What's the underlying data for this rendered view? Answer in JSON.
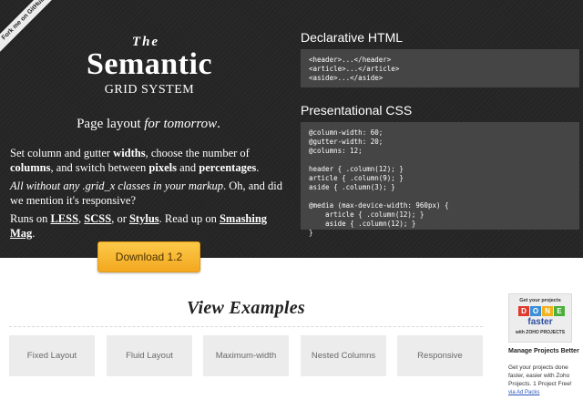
{
  "ribbon": {
    "label": "Fork me on GitHub"
  },
  "hero": {
    "title_the": "The",
    "title_main": "Semantic",
    "title_sub": "GRID SYSTEM",
    "tagline_a": "Page layout ",
    "tagline_b": "for tomorrow",
    "tagline_c": ".",
    "p1": {
      "t1": "Set column and gutter ",
      "b1": "widths",
      "t2": ", choose the number of ",
      "b2": "columns",
      "t3": ", and switch between ",
      "b3": "pixels",
      "t4": " and ",
      "b4": "percentages",
      "t5": "."
    },
    "p2": {
      "i1": "All without any .grid_x classes in your markup",
      "t1": ". Oh, and did we mention it's responsive?"
    },
    "p3": {
      "t1": "Runs on ",
      "l1": "LESS",
      "t2": ", ",
      "l2": "SCSS",
      "t3": ", or ",
      "l3": "Stylus",
      "t4": ". Read up on ",
      "l4": "Smashing Mag",
      "t5": "."
    },
    "download_label": "Download 1.2"
  },
  "code": {
    "heading1": "Declarative HTML",
    "html_code": "<header>...</header>\n<article>...</article>\n<aside>...</aside>",
    "heading2": "Presentational CSS",
    "css_code": "@column-width: 60;\n@gutter-width: 20;\n@columns: 12;\n\nheader { .column(12); }\narticle { .column(9); }\naside { .column(3); }\n\n@media (max-device-width: 960px) {\n    article { .column(12); }\n    aside { .column(12); }\n}"
  },
  "examples": {
    "title": "View Examples",
    "buttons": [
      "Fixed Layout",
      "Fluid Layout",
      "Maximum-width",
      "Nested Columns",
      "Responsive"
    ]
  },
  "ad": {
    "top": "Get your projects",
    "done_letters": [
      "D",
      "O",
      "N",
      "E"
    ],
    "done_colors": [
      "#e03a2f",
      "#3a8fd8",
      "#f2b21c",
      "#4caf3b"
    ],
    "faster": "faster",
    "with": "with ZOHO PROJECTS",
    "headline": "Manage Projects Better",
    "text": "Get your projects done faster, easier with Zoho Projects. 1 Project Free!",
    "via": "via Ad Packs"
  }
}
